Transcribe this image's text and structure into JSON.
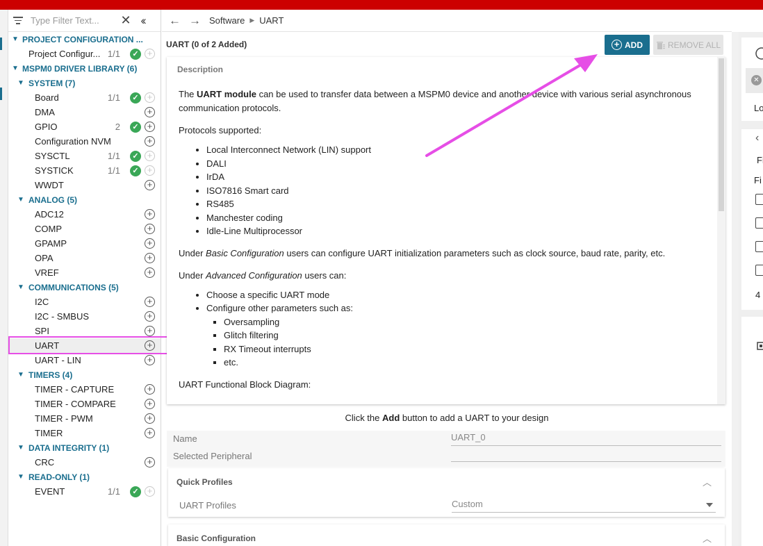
{
  "filter": {
    "placeholder": "Type Filter Text..."
  },
  "breadcrumb": {
    "items": [
      "Software",
      "UART"
    ]
  },
  "tree": [
    {
      "type": "cat",
      "label": "PROJECT CONFIGURATION ...",
      "level": 0
    },
    {
      "type": "item",
      "label": "Project Configur...",
      "count": "1/1",
      "check": true,
      "plus_dim": true,
      "level": 0
    },
    {
      "type": "cat",
      "label": "MSPM0 DRIVER LIBRARY (6)",
      "level": 0
    },
    {
      "type": "cat",
      "label": "SYSTEM (7)",
      "level": 1
    },
    {
      "type": "item",
      "label": "Board",
      "count": "1/1",
      "check": true,
      "plus_dim": true,
      "level": 1
    },
    {
      "type": "item",
      "label": "DMA",
      "count": "",
      "check": false,
      "plus_dim": false,
      "level": 1
    },
    {
      "type": "item",
      "label": "GPIO",
      "count": "2",
      "check": true,
      "plus_dim": false,
      "level": 1
    },
    {
      "type": "item",
      "label": "Configuration NVM",
      "count": "",
      "check": false,
      "plus_dim": false,
      "level": 1
    },
    {
      "type": "item",
      "label": "SYSCTL",
      "count": "1/1",
      "check": true,
      "plus_dim": true,
      "level": 1
    },
    {
      "type": "item",
      "label": "SYSTICK",
      "count": "1/1",
      "check": true,
      "plus_dim": true,
      "level": 1
    },
    {
      "type": "item",
      "label": "WWDT",
      "count": "",
      "check": false,
      "plus_dim": false,
      "level": 1
    },
    {
      "type": "cat",
      "label": "ANALOG (5)",
      "level": 1
    },
    {
      "type": "item",
      "label": "ADC12",
      "count": "",
      "check": false,
      "plus_dim": false,
      "level": 1
    },
    {
      "type": "item",
      "label": "COMP",
      "count": "",
      "check": false,
      "plus_dim": false,
      "level": 1
    },
    {
      "type": "item",
      "label": "GPAMP",
      "count": "",
      "check": false,
      "plus_dim": false,
      "level": 1
    },
    {
      "type": "item",
      "label": "OPA",
      "count": "",
      "check": false,
      "plus_dim": false,
      "level": 1
    },
    {
      "type": "item",
      "label": "VREF",
      "count": "",
      "check": false,
      "plus_dim": false,
      "level": 1
    },
    {
      "type": "cat",
      "label": "COMMUNICATIONS (5)",
      "level": 1
    },
    {
      "type": "item",
      "label": "I2C",
      "count": "",
      "check": false,
      "plus_dim": false,
      "level": 1
    },
    {
      "type": "item",
      "label": "I2C - SMBUS",
      "count": "",
      "check": false,
      "plus_dim": false,
      "level": 1
    },
    {
      "type": "item",
      "label": "SPI",
      "count": "",
      "check": false,
      "plus_dim": false,
      "level": 1
    },
    {
      "type": "item",
      "label": "UART",
      "count": "",
      "check": false,
      "plus_dim": false,
      "level": 1,
      "selected": true
    },
    {
      "type": "item",
      "label": "UART - LIN",
      "count": "",
      "check": false,
      "plus_dim": false,
      "level": 1
    },
    {
      "type": "cat",
      "label": "TIMERS (4)",
      "level": 1
    },
    {
      "type": "item",
      "label": "TIMER - CAPTURE",
      "count": "",
      "check": false,
      "plus_dim": false,
      "level": 1
    },
    {
      "type": "item",
      "label": "TIMER - COMPARE",
      "count": "",
      "check": false,
      "plus_dim": false,
      "level": 1
    },
    {
      "type": "item",
      "label": "TIMER - PWM",
      "count": "",
      "check": false,
      "plus_dim": false,
      "level": 1
    },
    {
      "type": "item",
      "label": "TIMER",
      "count": "",
      "check": false,
      "plus_dim": false,
      "level": 1
    },
    {
      "type": "cat",
      "label": "DATA INTEGRITY (1)",
      "level": 1
    },
    {
      "type": "item",
      "label": "CRC",
      "count": "",
      "check": false,
      "plus_dim": false,
      "level": 1
    },
    {
      "type": "cat",
      "label": "READ-ONLY (1)",
      "level": 1
    },
    {
      "type": "item",
      "label": "EVENT",
      "count": "1/1",
      "check": true,
      "plus_dim": true,
      "level": 1
    }
  ],
  "main": {
    "title": "UART (0 of 2 Added)",
    "add_label": "ADD",
    "remove_all_label": "REMOVE ALL",
    "description": {
      "heading": "Description",
      "intro_pre": "The ",
      "intro_bold": "UART module",
      "intro_post": " can be used to transfer data between a MSPM0 device and another device with various serial asynchronous communication protocols.",
      "protocols_heading": "Protocols supported:",
      "protocols": [
        "Local Interconnect Network (LIN) support",
        "DALI",
        "IrDA",
        "ISO7816 Smart card",
        "RS485",
        "Manchester coding",
        "Idle-Line Multiprocessor"
      ],
      "basic_pre": "Under ",
      "basic_em": "Basic Configuration",
      "basic_post": " users can configure UART initialization parameters such as clock source, baud rate, parity, etc.",
      "adv_pre": "Under ",
      "adv_em": "Advanced Configuration",
      "adv_post": " users can:",
      "adv_items": [
        "Choose a specific UART mode",
        "Configure other parameters such as:"
      ],
      "adv_sub": [
        "Oversampling",
        "Glitch filtering",
        "RX Timeout interrupts",
        "etc."
      ],
      "diagram_label": "UART Functional Block Diagram:"
    },
    "hint_pre": "Click the ",
    "hint_bold": "Add",
    "hint_post": " button to add a UART to your design",
    "form": {
      "name_label": "Name",
      "name_value": "UART_0",
      "peripheral_label": "Selected Peripheral",
      "peripheral_value": ""
    },
    "quick_profiles": {
      "title": "Quick Profiles",
      "profile_label": "UART Profiles",
      "profile_value": "Custom"
    },
    "basic_config": {
      "title": "Basic Configuration"
    }
  },
  "right_panel": {
    "items": [
      "Lo",
      "Fi",
      "Fi",
      "4"
    ]
  },
  "colors": {
    "accent": "#1a6e8e",
    "topbar": "#cc0000",
    "annotation": "#e64ee6",
    "success": "#3aa757"
  }
}
